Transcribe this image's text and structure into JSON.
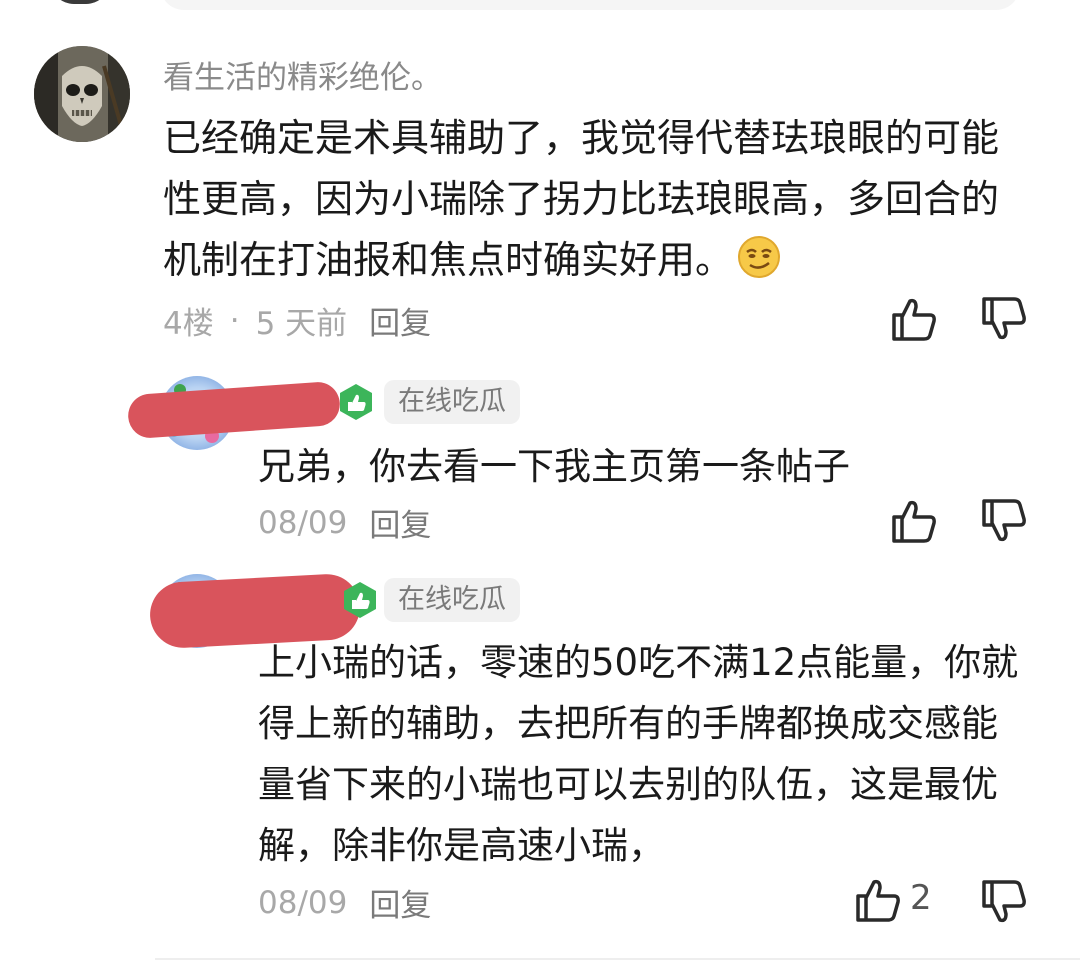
{
  "comment": {
    "username": "看生活的精彩绝伦。",
    "text": "已经确定是术具辅助了，我觉得代替珐琅眼的可能性更高，因为小瑞除了拐力比珐琅眼高，多回合的机制在打油报和焦点时确实好用。",
    "floor": "4楼",
    "dot": "·",
    "time": "5 天前",
    "reply_label": "回复",
    "avatar_icon": "skull-mask-avatar",
    "emoji": "smirk-emoji"
  },
  "replies": [
    {
      "tag": "在线吃瓜",
      "text": "兄弟，你去看一下我主页第一条帖子",
      "date": "08/09",
      "reply_label": "回复",
      "like_count": ""
    },
    {
      "tag": "在线吃瓜",
      "text": "上小瑞的话，零速的50吃不满12点能量，你就得上新的辅助，去把所有的手牌都换成交感能量省下来的小瑞也可以去别的队伍，这是最优解，除非你是高速小瑞，",
      "date": "08/09",
      "reply_label": "回复",
      "like_count": "2"
    }
  ],
  "colors": {
    "redaction": "#d9545c",
    "badge_green": "#3cb55a",
    "muted": "#a8a8a8"
  }
}
